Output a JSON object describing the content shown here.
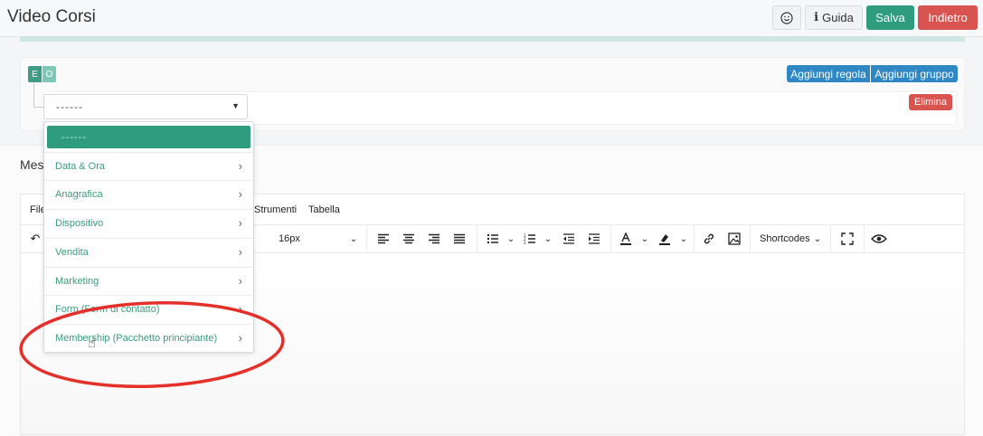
{
  "header": {
    "title": "Video Corsi",
    "emoji_icon": "smiley-icon",
    "guida_label": "Guida",
    "salva_label": "Salva",
    "indietro_label": "Indietro"
  },
  "query_builder": {
    "toggle_e": "E",
    "toggle_o": "O",
    "add_rule_label": "Aggiungi regola",
    "add_group_label": "Aggiungi gruppo",
    "delete_label": "Elimina",
    "select_value": "------"
  },
  "dropdown": {
    "selected": "------",
    "items": [
      {
        "label": "Data & Ora"
      },
      {
        "label": "Anagrafica"
      },
      {
        "label": "Dispositivo"
      },
      {
        "label": "Vendita"
      },
      {
        "label": "Marketing"
      },
      {
        "label": "Form (Form di contatto)"
      },
      {
        "label": "Membership (Pacchetto principiante)"
      }
    ]
  },
  "message": {
    "title": "Messaggio",
    "menubar": [
      "File",
      "Strumenti",
      "Tabella"
    ],
    "font_size": "16px",
    "shortcodes_label": "Shortcodes"
  },
  "colors": {
    "primary": "#2f9c7e",
    "danger": "#d9534f",
    "info": "#2f87c3",
    "annotation": "#e5302a"
  }
}
